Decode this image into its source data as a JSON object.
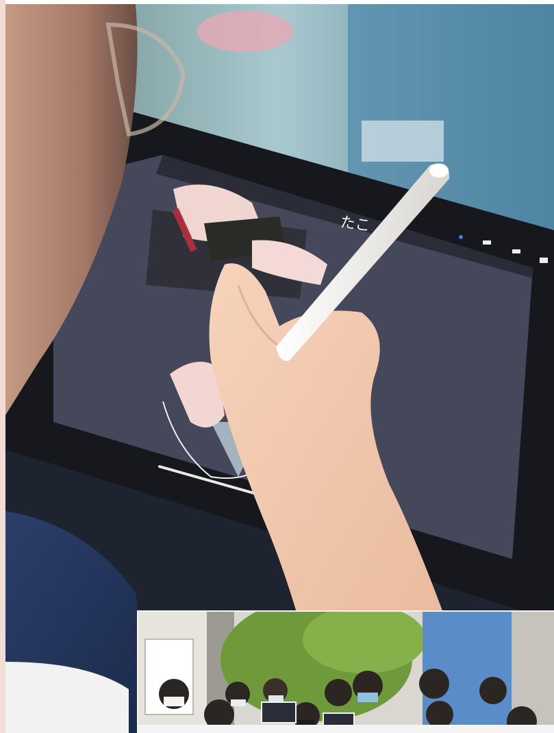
{
  "main_photo": {
    "screen_text": "たこ"
  },
  "inset_photo": {},
  "colors": {
    "tablet_bezel": "#16181e",
    "canvas": "#4a4b5c",
    "stylus": "#f2f0ec",
    "skin": "#f0c7aa",
    "sky": "#5a8cc8",
    "foliage": "#6f9a3c"
  }
}
